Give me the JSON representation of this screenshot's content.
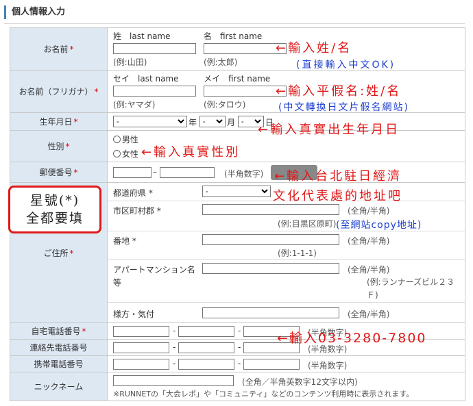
{
  "section_title": "個人情報入力",
  "fields": {
    "name": {
      "label": "お名前",
      "required_mark": "*",
      "last_heading": "姓　last name",
      "first_heading": "名　first name",
      "last_example": "(例:山田)",
      "first_example": "(例:太郎)",
      "last_value": "",
      "first_value": ""
    },
    "furigana": {
      "label": "お名前（フリガナ）",
      "required_mark": "*",
      "last_heading": "セイ　last name",
      "first_heading": "メイ　first name",
      "last_example": "(例:ヤマダ)",
      "first_example": "(例:タロウ)"
    },
    "birthday": {
      "label": "生年月日",
      "required_mark": "*",
      "year_value": "-",
      "year_unit": "年",
      "month_value": "-",
      "month_unit": "月",
      "day_value": "-",
      "day_unit": "日"
    },
    "gender": {
      "label": "性別",
      "required_mark": "*",
      "options": [
        "男性",
        "女性"
      ]
    },
    "postal": {
      "label": "郵便番号",
      "required_mark": "*",
      "separator": "–",
      "note": "(半角数字)"
    },
    "address": {
      "label": "ご住所",
      "required_mark": "*",
      "prefecture_label": "都道府県",
      "prefecture_required": "*",
      "prefecture_value": "-",
      "city_label": "市区町村郡",
      "city_required": "*",
      "city_note": "(全角/半角)",
      "city_example": "(例:目黒区原町)",
      "street_label": "番地",
      "street_required": "*",
      "street_note": "(全角/半角)",
      "street_example": "(例:1-1-1)",
      "building_label": "アパートマンション名等",
      "building_note": "(全角/半角)",
      "building_example": "(例:ランナーズビル２３Ｆ)",
      "care_of_label": "様方・気付",
      "care_of_note": "(全角/半角)"
    },
    "home_phone": {
      "label": "自宅電話番号",
      "required_mark": "*",
      "separator": "-",
      "note": "(半角数字)"
    },
    "contact_phone": {
      "label": "連絡先電話番号",
      "separator": "-",
      "note": "(半角数字)"
    },
    "mobile_phone": {
      "label": "携帯電話番号",
      "separator": "-",
      "note": "(半角数字)"
    },
    "nickname": {
      "label": "ニックネーム",
      "note": "(全角／半角英数字12文字以内)",
      "description": "※RUNNETの「大会レポ」や「コミュニティ」などのコンテンツ利用時に表示されます。"
    }
  },
  "annotations": {
    "name": "←輸入姓/名",
    "name_sub": "(直接輸入中文OK)",
    "furigana": "←輸入平假名:姓/名",
    "furigana_sub": "(中文轉換日文片假名網站)",
    "birthday": "←輸入真實出生年月日",
    "gender": "←輸入真實性別",
    "address_1": "←輸入台北駐日經濟",
    "address_2": "文化代表處的地址吧",
    "address_sub": "(至網站copy地址)",
    "phone": "←輸入03-3280-7800",
    "callout_line1": "星號(*)",
    "callout_line2": "全都要填"
  },
  "colors": {
    "label_bg": "#dde8f3",
    "annotation_red": "#e01818",
    "annotation_blue": "#1a3fd0",
    "required_red": "#dd0000"
  }
}
